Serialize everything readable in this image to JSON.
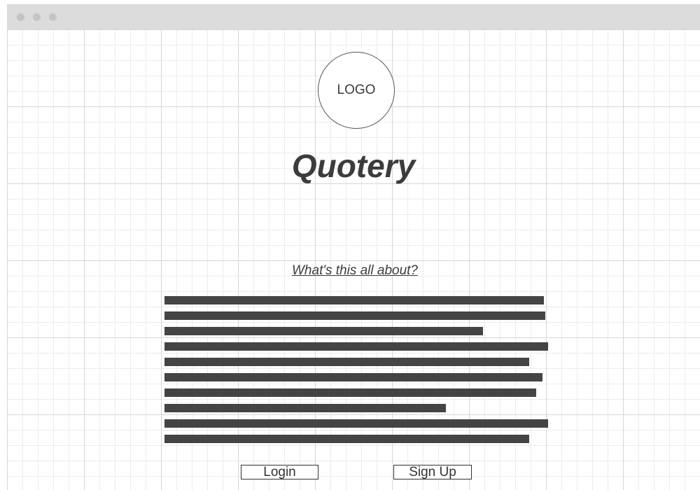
{
  "window": {
    "controls": [
      "close",
      "minimize",
      "maximize"
    ]
  },
  "page": {
    "logo_text": "LOGO",
    "title": "Quotery",
    "about_link": "What's this all about?",
    "text_placeholder_lines": 10,
    "buttons": {
      "login": "Login",
      "signup": "Sign Up"
    }
  },
  "colors": {
    "titlebar": "#dcdcdc",
    "window_dot": "#c4c4c4",
    "grid_line": "#ececec",
    "text": "#3c3c3c",
    "placeholder_bar": "#444444"
  }
}
